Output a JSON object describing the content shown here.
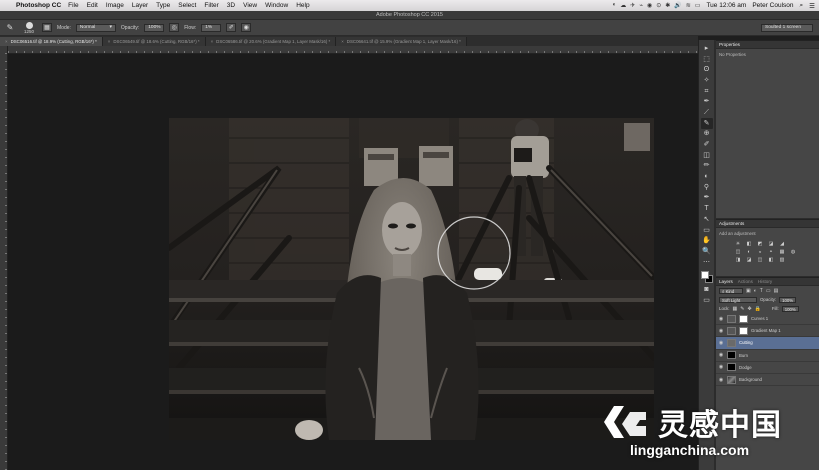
{
  "menubar": {
    "apple_glyph": "",
    "app_name": "Photoshop CC",
    "items": [
      "File",
      "Edit",
      "Image",
      "Layer",
      "Type",
      "Select",
      "Filter",
      "3D",
      "View",
      "Window",
      "Help"
    ],
    "clock": "Tue 12:06 am",
    "user": "Peter Coulson",
    "tray_glyphs": [
      "◐",
      "☁",
      "✈",
      "⌁",
      "◉",
      "⊙",
      "✱",
      "🔊",
      "≋",
      "▭"
    ],
    "search_glyph": "⌕",
    "list_glyph": "☰"
  },
  "window": {
    "title": "Adobe Photoshop CC 2015"
  },
  "options": {
    "brush_size": "1250",
    "mode_label": "Mode:",
    "mode_value": "Normal",
    "opacity_label": "Opacity:",
    "opacity_value": "100%",
    "flow_label": "Flow:",
    "flow_value": "1%",
    "workspace": "Soulted 1 screen"
  },
  "tabs": [
    {
      "label": "DSC06516.tif @ 18.9% (Cutting, RGB/16*) *",
      "active": true
    },
    {
      "label": "DSC06549.tif @ 18.6% (Cutting, RGB/16*) *",
      "active": false
    },
    {
      "label": "DSC06586.tif @ 20.6% (Gradient Map 1, Layer Mask/16) *",
      "active": false
    },
    {
      "label": "DSC06641.tif @ 15.9% (Gradient Map 1, Layer Mask/16) *",
      "active": false
    }
  ],
  "tools": [
    "▸",
    "⬚",
    "ʘ",
    "✧",
    "⌗",
    "✒",
    "⟋",
    "✎",
    "⊕",
    "✐",
    "◫",
    "✏",
    "◐",
    "⚲",
    "✒",
    "T",
    "↖",
    "▭",
    "✋",
    "🔍"
  ],
  "panels": {
    "properties": {
      "title": "Properties",
      "body": "No Properties"
    },
    "adjustments": {
      "title": "Adjustments",
      "subtitle": "Add an adjustment",
      "icons": [
        "☀",
        "◧",
        "◩",
        "◪",
        "◢",
        "▽",
        "◫",
        "◐",
        "◒",
        "◓",
        "▦",
        "◍",
        "◨",
        "◪",
        "◫",
        "◧",
        "▨",
        "◩"
      ]
    },
    "layers": {
      "tabs": [
        "Layers",
        "Actions",
        "History"
      ],
      "filter_label": "Kind",
      "blend_mode": "Soft Light",
      "opacity_label": "Opacity:",
      "opacity_value": "100%",
      "lock_label": "Lock:",
      "fill_label": "Fill:",
      "fill_value": "100%",
      "rows": [
        {
          "name": "Curves 1",
          "thumb": "adj",
          "mask": "white",
          "selected": false
        },
        {
          "name": "Gradient Map 1",
          "thumb": "adj",
          "mask": "white",
          "selected": false
        },
        {
          "name": "Cutting",
          "thumb": "grey",
          "mask": "",
          "selected": true
        },
        {
          "name": "Burn",
          "thumb": "black",
          "mask": "",
          "selected": false
        },
        {
          "name": "Dodge",
          "thumb": "black",
          "mask": "",
          "selected": false
        },
        {
          "name": "Background",
          "thumb": "photo-th",
          "mask": "",
          "selected": false
        }
      ]
    }
  },
  "watermark": {
    "brand_cn": "灵感中国",
    "url": "lingganchina.com"
  }
}
